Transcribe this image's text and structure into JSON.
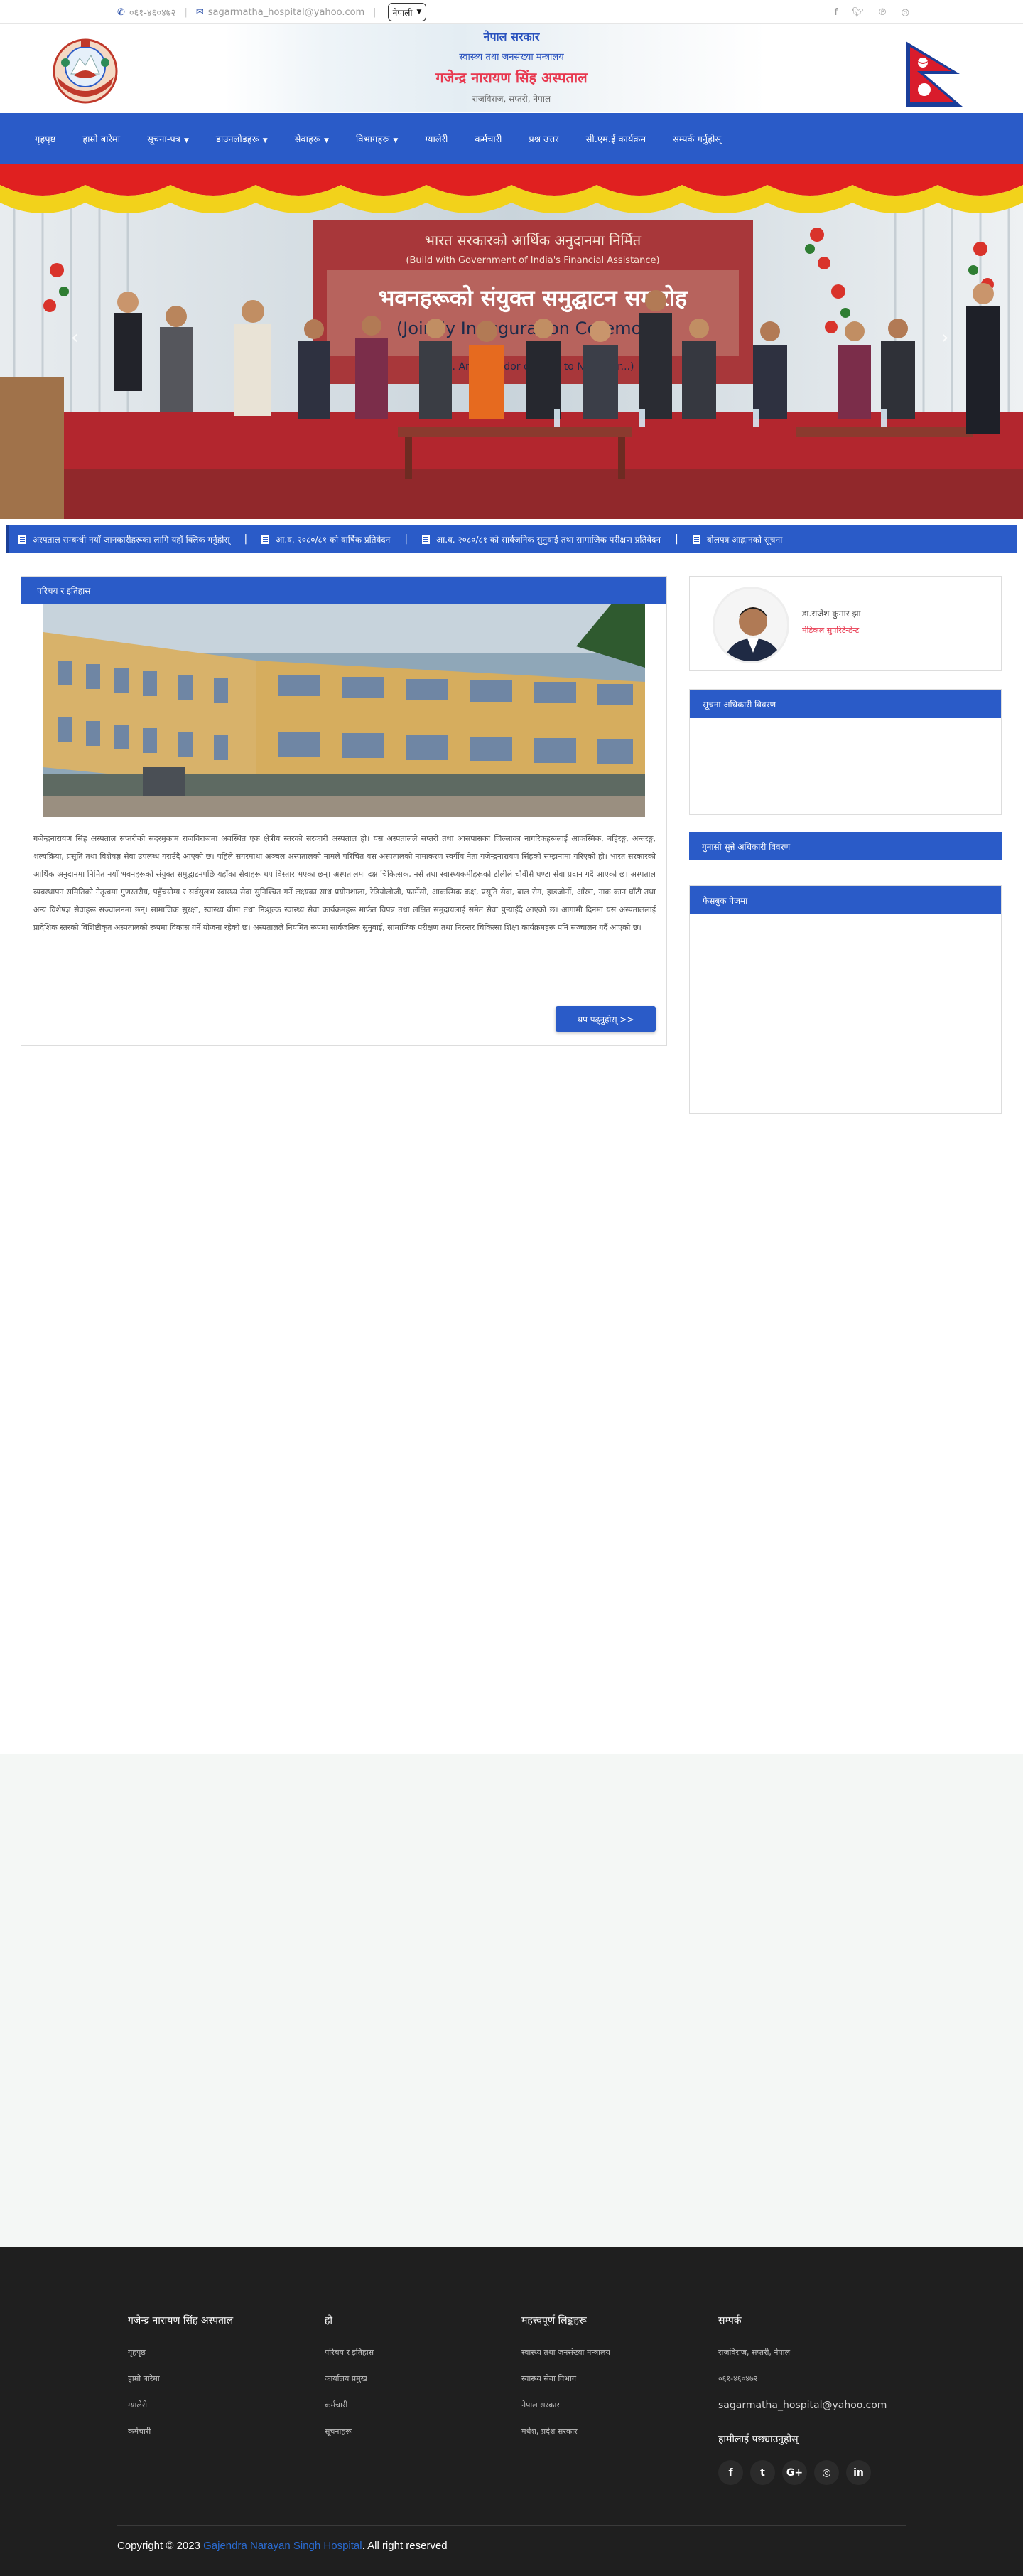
{
  "topbar": {
    "phone": "०६१-४६०४७२",
    "email": "sagarmatha_hospital@yahoo.com",
    "language": "नेपाली",
    "social_icons": [
      "facebook-icon",
      "twitter-icon",
      "pinterest-icon",
      "instagram-icon"
    ]
  },
  "header": {
    "line1": "नेपाल सरकार",
    "line2": "स्वास्थ्य तथा जनसंख्या मन्त्रालय",
    "line3": "गजेन्द्र नारायण सिंह अस्पताल",
    "line4": "राजविराज, सप्तरी, नेपाल"
  },
  "nav": {
    "items": [
      {
        "label": "गृहपृष्ठ",
        "dropdown": false
      },
      {
        "label": "हाम्रो बारेमा",
        "dropdown": false
      },
      {
        "label": "सूचना-पत्र",
        "dropdown": true
      },
      {
        "label": "डाउनलोडहरू",
        "dropdown": true
      },
      {
        "label": "सेवाहरू",
        "dropdown": true
      },
      {
        "label": "विभागहरू",
        "dropdown": true
      },
      {
        "label": "ग्यालेरी",
        "dropdown": false
      },
      {
        "label": "कर्मचारी",
        "dropdown": false
      },
      {
        "label": "प्रश्न उत्तर",
        "dropdown": false
      },
      {
        "label": "सी.एम.ई कार्यक्रम",
        "dropdown": false
      },
      {
        "label": "सम्पर्क गर्नुहोस्",
        "dropdown": false
      }
    ]
  },
  "slider": {
    "banner_line1": "भवनहरूको संयुक्त समुद्घाटन समारोह",
    "banner_line2": "(Jointly Inauguration Ceremony)",
    "banner_top": "भारत सरकारको आर्थिक अनुदानमा निर्मित",
    "banner_top_en": "(Build with Government of India's Financial Assistance)",
    "banner_bottom": "(H.E. Ambassador of India to Nepal Mr...)"
  },
  "ticker": {
    "items": [
      "अस्पताल सम्बन्धी नयाँ जानकारीहरूका लागि यहाँ क्लिक गर्नुहोस्",
      "आ.व. २०८०/८१ को वार्षिक प्रतिवेदन",
      "आ.व. २०८०/८१ को सार्वजनिक सुनुवाई तथा सामाजिक परीक्षण प्रतिवेदन",
      "बोलपत्र आह्वानको सूचना"
    ]
  },
  "about": {
    "heading": "परिचय र इतिहास",
    "text": "गजेन्द्रनारायण सिंह अस्पताल सप्तरीको सदरमुकाम राजविराजमा अवस्थित एक क्षेत्रीय स्तरको सरकारी अस्पताल हो। यस अस्पतालले सप्तरी तथा आसपासका जिल्लाका नागरिकहरूलाई आकस्मिक, बहिरङ्ग, अन्तरङ्ग, शल्यक्रिया, प्रसूति तथा विशेषज्ञ सेवा उपलब्ध गराउँदै आएको छ। पहिले सगरमाथा अञ्चल अस्पतालको नामले परिचित यस अस्पतालको नामाकरण स्वर्गीय नेता गजेन्द्रनारायण सिंहको सम्झनामा गरिएको हो। भारत सरकारको आर्थिक अनुदानमा निर्मित नयाँ भवनहरूको संयुक्त समुद्घाटनपछि यहाँका सेवाहरू थप विस्तार भएका छन्। अस्पतालमा दक्ष चिकित्सक, नर्स तथा स्वास्थ्यकर्मीहरूको टोलीले चौबीसै घण्टा सेवा प्रदान गर्दै आएको छ। अस्पताल व्यवस्थापन समितिको नेतृत्वमा गुणस्तरीय, पहुँचयोग्य र सर्वसुलभ स्वास्थ्य सेवा सुनिश्चित गर्ने लक्ष्यका साथ प्रयोगशाला, रेडियोलोजी, फार्मेसी, आकस्मिक कक्ष, प्रसूति सेवा, बाल रोग, हाडजोर्नी, आँखा, नाक कान घाँटी तथा अन्य विशेषज्ञ सेवाहरू सञ्चालनमा छन्। सामाजिक सुरक्षा, स्वास्थ्य बीमा तथा निःशुल्क स्वास्थ्य सेवा कार्यक्रमहरू मार्फत विपन्न तथा लक्षित समुदायलाई समेत सेवा पुर्‍याइँदै आएको छ। आगामी दिनमा यस अस्पताललाई प्रादेशिक स्तरको विशिष्टीकृत अस्पतालको रूपमा विकास गर्ने योजना रहेको छ। अस्पतालले नियमित रूपमा सार्वजनिक सुनुवाई, सामाजिक परीक्षण तथा निरन्तर चिकित्सा शिक्षा कार्यक्रमहरू पनि सञ्चालन गर्दै आएको छ।",
    "read_more": "थप पढ्नुहोस् >>"
  },
  "profile": {
    "name": "डा.राजेश कुमार झा",
    "title": "मेडिकल सुपरिटेन्डेन्ट"
  },
  "sidebar": {
    "box1_heading": "सूचना अधिकारी विवरण",
    "box2_heading": "गुनासो सुन्ने अधिकारी विवरण",
    "box3_heading": "फेसबुक पेजमा"
  },
  "footer": {
    "col1": {
      "title": "गजेन्द्र नारायण सिंह अस्पताल",
      "links": [
        "गृहपृष्ठ",
        "हाम्रो बारेमा",
        "ग्यालेरी",
        "कर्मचारी"
      ]
    },
    "col2": {
      "title": "हो",
      "links": [
        "परिचय र इतिहास",
        "कार्यालय प्रमुख",
        "कर्मचारी",
        "सूचनाहरू"
      ]
    },
    "col3": {
      "title": "महत्त्वपूर्ण लिङ्कहरू",
      "links": [
        "स्वास्थ्य तथा जनसंख्या मन्त्रालय",
        "स्वास्थ्य सेवा विभाग",
        "नेपाल सरकार",
        "मधेश, प्रदेश सरकार"
      ]
    },
    "col4": {
      "title": "सम्पर्क",
      "address": "राजविराज, सप्तरी, नेपाल",
      "phone": "०६१-४६०४७२",
      "email": "sagarmatha_hospital@yahoo.com",
      "follow_title": "हामीलाई पछ्याउनुहोस्"
    },
    "social": [
      "f",
      "t",
      "G+",
      "◎",
      "in"
    ],
    "copyright_prefix": "Copyright © 2023 ",
    "copyright_name": "Gajendra Narayan Singh Hospital",
    "copyright_suffix": ". All right reserved"
  },
  "colors": {
    "primary": "#2a5bc8",
    "accent_red": "#e8384f",
    "footer_bg": "#1f1f1f"
  }
}
